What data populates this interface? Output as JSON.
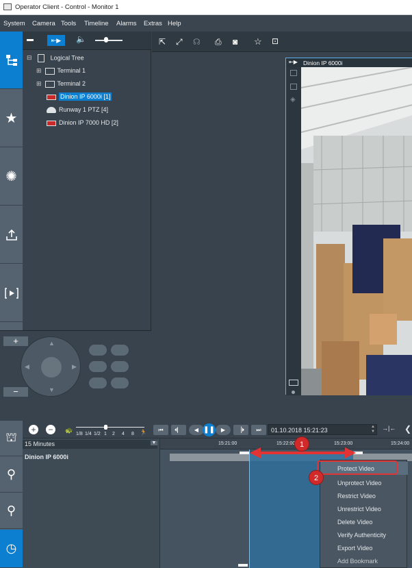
{
  "window": {
    "title": "Operator Client - Control - Monitor 1"
  },
  "menu": [
    "System",
    "Camera",
    "Tools",
    "Timeline",
    "Alarms",
    "Extras",
    "Help"
  ],
  "tree": {
    "root": "Logical Tree",
    "items": [
      {
        "label": "Terminal 1",
        "type": "folder"
      },
      {
        "label": "Terminal 2",
        "type": "folder"
      },
      {
        "label": "Dinion IP 6000i [1]",
        "type": "camera",
        "selected": true
      },
      {
        "label": "Runway 1 PTZ [4]",
        "type": "ptz"
      },
      {
        "label": "Dinion IP 7000 HD [2]",
        "type": "camera"
      }
    ]
  },
  "video": {
    "title": "Dinion IP 6000i"
  },
  "speed_labels": [
    "1/8",
    "1/4",
    "1/2",
    "1",
    "2",
    "4",
    "8"
  ],
  "timeline": {
    "datetime": "01.10.2018 15:21:23",
    "span": "15 Minutes",
    "ticks": [
      "15:21:00",
      "15:22:00",
      "15:23:00",
      "15:24:00"
    ],
    "camera": "Dinion IP 6000i"
  },
  "context_menu": [
    {
      "label": "Protect Video",
      "highlighted": true
    },
    {
      "label": "Unprotect Video"
    },
    {
      "label": "Restrict Video"
    },
    {
      "label": "Unrestrict Video"
    },
    {
      "label": "Delete Video"
    },
    {
      "label": "Verify Authenticity"
    },
    {
      "label": "Export Video"
    },
    {
      "label": "Add Bookmark"
    }
  ],
  "annotations": {
    "badge1": "1",
    "badge2": "2"
  },
  "colors": {
    "accent": "#0c7fd0",
    "marker": "#d12a2a",
    "nav": "#556370"
  }
}
